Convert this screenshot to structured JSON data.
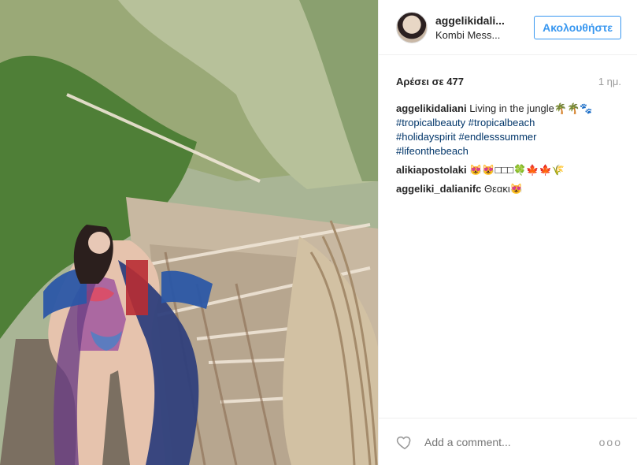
{
  "post": {
    "image_label": "",
    "header": {
      "username": "aggelikidali...",
      "location": "Kombi Mess...",
      "follow_label": "Ακολουθήστε"
    },
    "likes": "Αρέσει σε 477",
    "time": "1 ημ.",
    "caption": {
      "user": "aggelikidaliani",
      "text": "Living in the jungle🌴🌴🐾",
      "tags": [
        "#tropicalbeauty",
        "#tropicalbeach",
        "#holidayspirit",
        "#endlesssummer",
        "#lifeonthebeach"
      ]
    },
    "comments": [
      {
        "user": "alikiapostolaki",
        "text": "😻😻□□□🍀🍁🍁🌾"
      },
      {
        "user": "aggeliki_dalianifc",
        "text": "Θεακι😻"
      }
    ],
    "add_comment_placeholder": "Add a comment...",
    "more_label": "ooo"
  },
  "icons": {
    "heart": "heart-icon",
    "more": "more-options-icon"
  },
  "colors": {
    "accent": "#3897f0",
    "hashtag": "#003569",
    "muted": "#999999"
  }
}
